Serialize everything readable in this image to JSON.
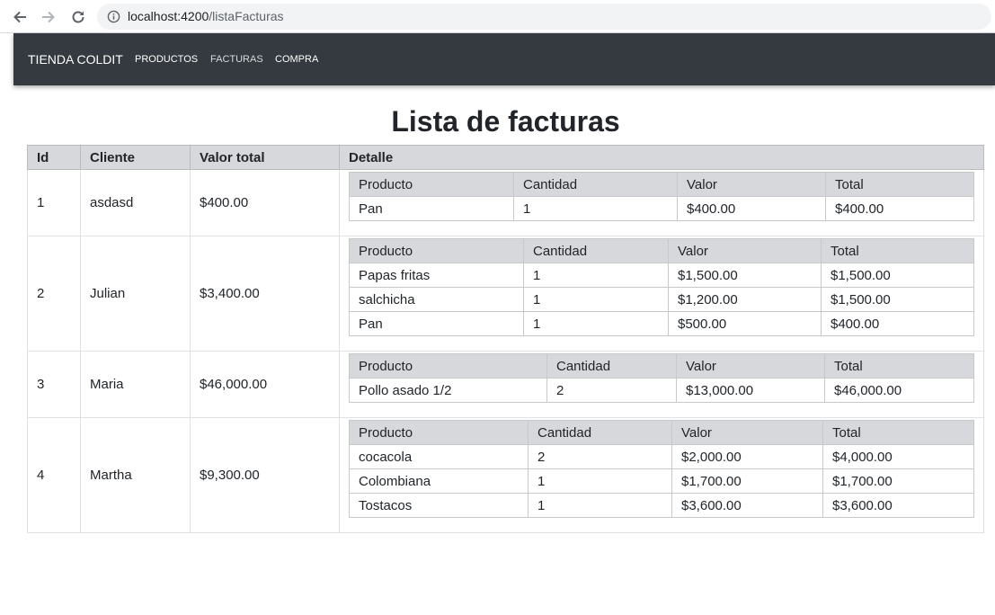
{
  "browser": {
    "url_host": "localhost:4200",
    "url_path": "/listaFacturas"
  },
  "navbar": {
    "brand": "TIENDA COLDIT",
    "links": [
      {
        "label": "PRODUCTOS"
      },
      {
        "label": "FACTURAS"
      },
      {
        "label": "COMPRA"
      }
    ]
  },
  "page": {
    "title": "Lista de facturas"
  },
  "table": {
    "headers": [
      "Id",
      "Cliente",
      "Valor total",
      "Detalle"
    ],
    "detail_headers": [
      "Producto",
      "Cantidad",
      "Valor",
      "Total"
    ],
    "rows": [
      {
        "id": "1",
        "cliente": "asdasd",
        "valor_total": "$400.00",
        "detalle": [
          {
            "producto": "Pan",
            "cantidad": "1",
            "valor": "$400.00",
            "total": "$400.00"
          }
        ]
      },
      {
        "id": "2",
        "cliente": "Julian",
        "valor_total": "$3,400.00",
        "detalle": [
          {
            "producto": "Papas fritas",
            "cantidad": "1",
            "valor": "$1,500.00",
            "total": "$1,500.00"
          },
          {
            "producto": "salchicha",
            "cantidad": "1",
            "valor": "$1,200.00",
            "total": "$1,500.00"
          },
          {
            "producto": "Pan",
            "cantidad": "1",
            "valor": "$500.00",
            "total": "$400.00"
          }
        ]
      },
      {
        "id": "3",
        "cliente": "Maria",
        "valor_total": "$46,000.00",
        "detalle": [
          {
            "producto": "Pollo asado 1/2",
            "cantidad": "2",
            "valor": "$13,000.00",
            "total": "$46,000.00"
          }
        ]
      },
      {
        "id": "4",
        "cliente": "Martha",
        "valor_total": "$9,300.00",
        "detalle": [
          {
            "producto": "cocacola",
            "cantidad": "2",
            "valor": "$2,000.00",
            "total": "$4,000.00"
          },
          {
            "producto": "Colombiana",
            "cantidad": "1",
            "valor": "$1,700.00",
            "total": "$1,700.00"
          },
          {
            "producto": "Tostacos",
            "cantidad": "1",
            "valor": "$3,600.00",
            "total": "$3,600.00"
          }
        ]
      }
    ]
  }
}
